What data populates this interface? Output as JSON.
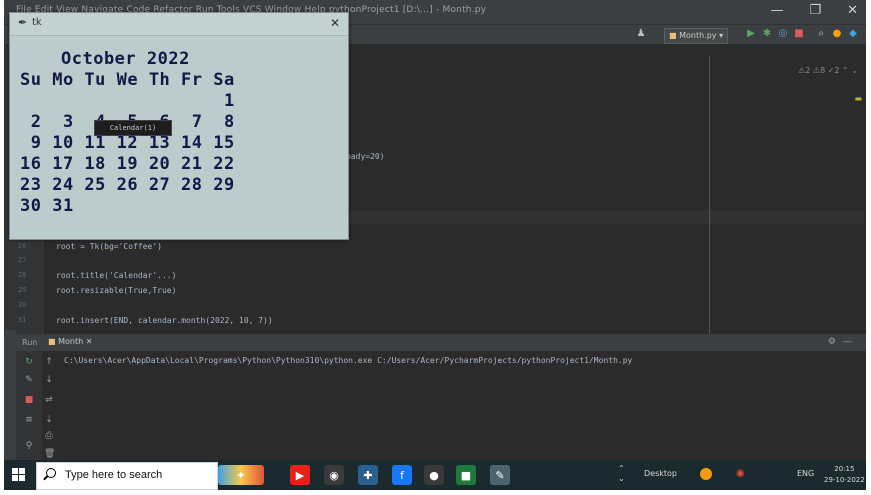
{
  "ide": {
    "menu": "File  Edit  View  Navigate  Code  Refactor  Run  Tools  VCS  Window  Help   pythonProject1 [D:\\...] - Month.py",
    "run_config": "Month.py",
    "code_lines": [
      {
        "no": "",
        "text": "pady=20)"
      },
      {
        "no": "26",
        "text": "root = Tk(bg='Coffee')"
      },
      {
        "no": "27",
        "text": ""
      },
      {
        "no": "28",
        "text": "root.title('Calendar'...)"
      },
      {
        "no": "29",
        "text": "root.resizable(True,True)"
      },
      {
        "no": "30",
        "text": ""
      },
      {
        "no": "31",
        "text": "root.insert(END, calendar.month(2022, 10, 7))"
      }
    ]
  },
  "run_panel": {
    "label": "Run",
    "tab": "Month",
    "output": "C:\\Users\\Acer\\AppData\\Local\\Programs\\Python\\Python310\\python.exe C:/Users/Acer/PycharmProjects/pythonProject1/Month.py"
  },
  "tk_window": {
    "title": "tk",
    "close": "✕",
    "month_header": "October 2022",
    "weekdays": "Su Mo Tu We Th Fr Sa",
    "weeks": [
      "                   1",
      " 2  3  4  5  6  7  8",
      " 9 10 11 12 13 14 15",
      "16 17 18 19 20 21 22",
      "23 24 25 26 27 28 29",
      "30 31"
    ],
    "tooltip": "Calendar(1)"
  },
  "taskbar": {
    "search_placeholder": "Type here to search",
    "desktop_label": "Desktop",
    "language": "ENG",
    "time": "20:15",
    "date": "29-10-2022",
    "icons": [
      "widgets-icon",
      "youtube-icon",
      "chrome-icon",
      "python-icon",
      "facebook-icon",
      "obs-icon",
      "pycharm-icon",
      "notepad-icon"
    ]
  },
  "colors": {
    "calendar_text": "#101a48",
    "calendar_bg": "#bccbcb",
    "ide_bg": "#2b2b2b",
    "taskbar_bg": "#1b2a2e"
  }
}
